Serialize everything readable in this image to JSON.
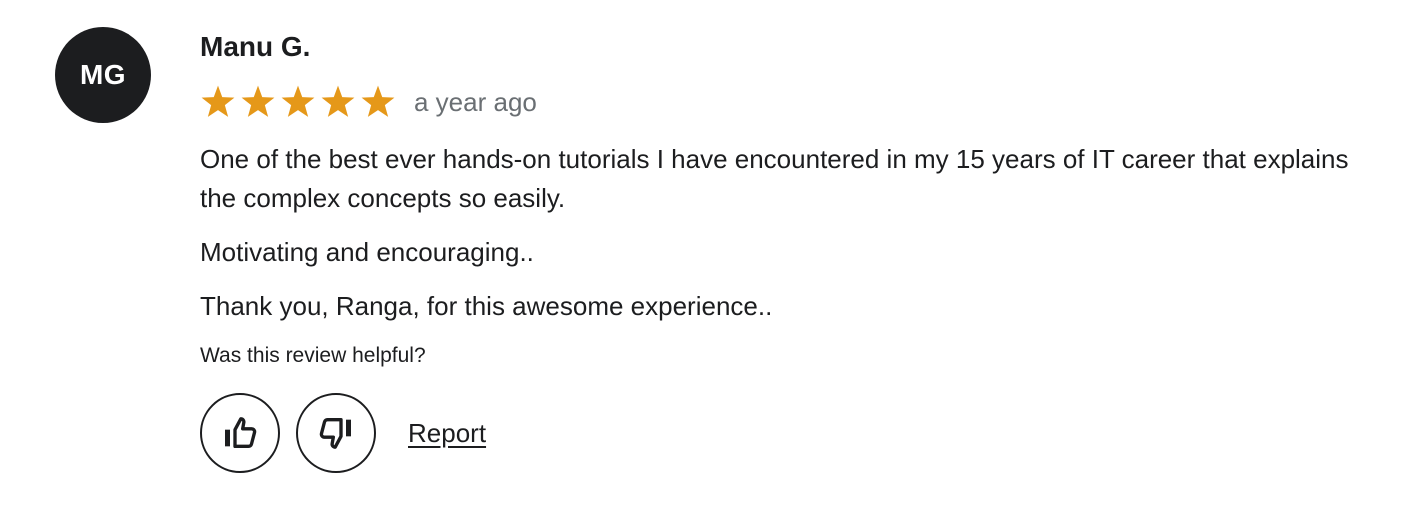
{
  "review": {
    "avatar_initials": "MG",
    "reviewer_name": "Manu G.",
    "rating": 5,
    "rating_max": 5,
    "star_color": "#e59819",
    "time_ago": "a year ago",
    "paragraphs": [
      "One of the best ever hands-on tutorials I have encountered in my 15 years of IT career that explains the complex concepts so easily.",
      "Motivating and encouraging..",
      "Thank you, Ranga, for this awesome experience.."
    ],
    "helpful_question": "Was this review helpful?",
    "actions": {
      "thumbs_up_icon": "thumbs-up-icon",
      "thumbs_down_icon": "thumbs-down-icon",
      "report_label": "Report"
    }
  }
}
